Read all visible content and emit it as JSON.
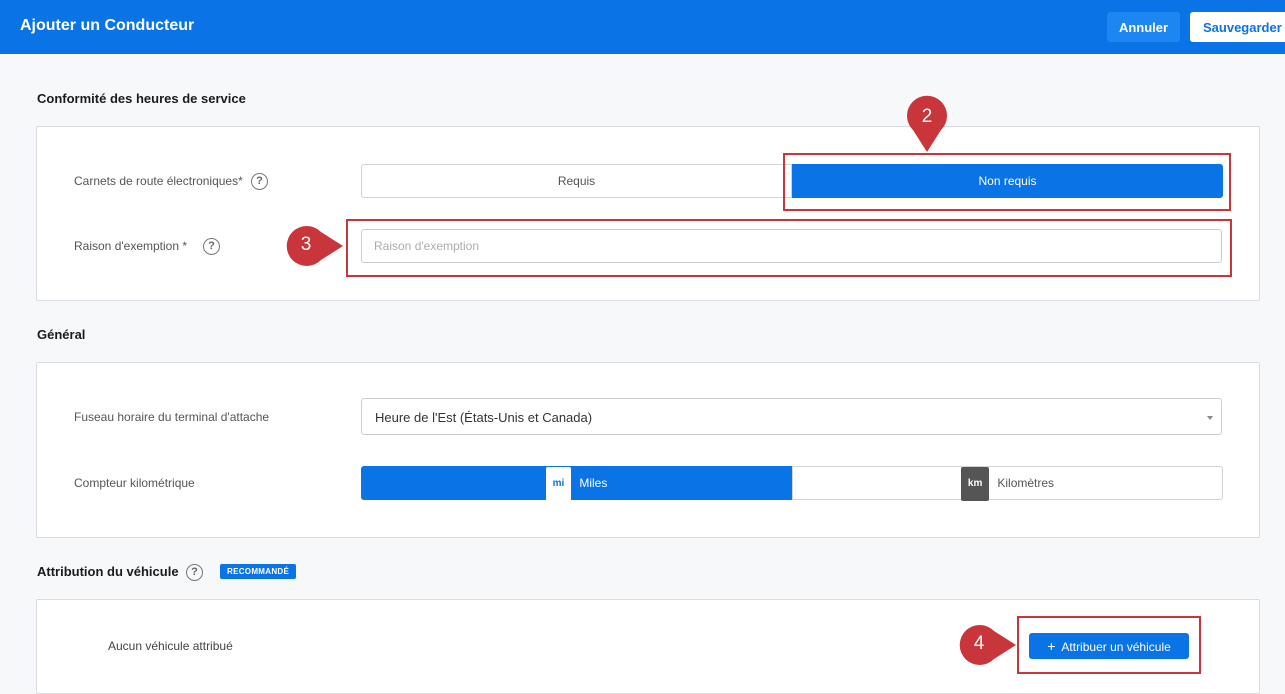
{
  "header": {
    "title": "Ajouter un Conducteur",
    "cancel_label": "Annuler",
    "save_label": "Sauvegarder"
  },
  "hos": {
    "section_title": "Conformité des heures de service",
    "eld_label": "Carnets de route électroniques*",
    "eld_options": [
      "Requis",
      "Non requis"
    ],
    "eld_selected": "Non requis",
    "exemption_label": "Raison d'exemption *",
    "exemption_placeholder": "Raison d'exemption",
    "exemption_value": ""
  },
  "general": {
    "section_title": "Général",
    "timezone_label": "Fuseau horaire du terminal d'attache",
    "timezone_value": "Heure de l'Est (États-Unis et Canada)",
    "odometer_label": "Compteur kilométrique",
    "odometer_options": [
      {
        "chip": "mi",
        "label": "Miles"
      },
      {
        "chip": "km",
        "label": "Kilomètres"
      }
    ],
    "odometer_selected": "Miles"
  },
  "vehicle": {
    "section_title": "Attribution du véhicule",
    "badge": "RECOMMANDÉ",
    "empty_text": "Aucun véhicule attribué",
    "assign_label": "Attribuer un véhicule"
  },
  "callouts": [
    "2",
    "3",
    "4"
  ],
  "colors": {
    "primary": "#0a73e6",
    "callout": "#c8353a"
  }
}
